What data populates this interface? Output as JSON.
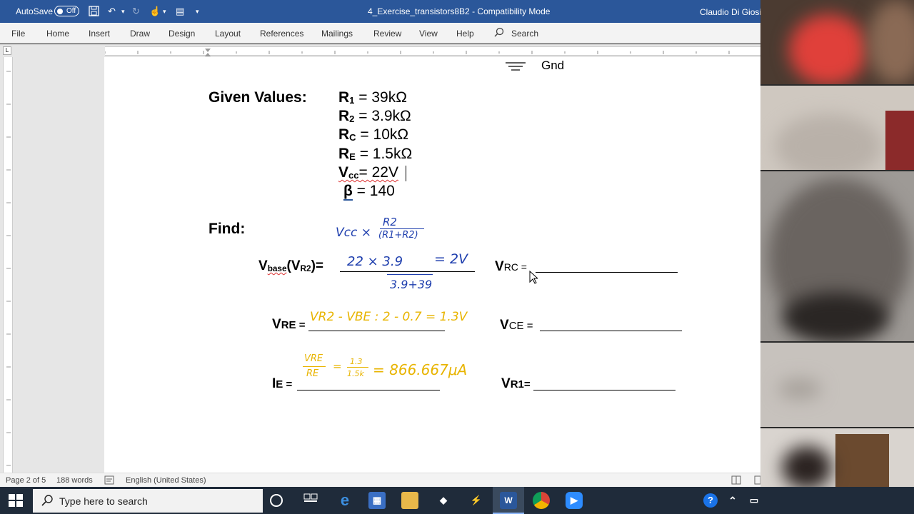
{
  "titlebar": {
    "autosave_label": "AutoSave",
    "autosave_state": "Off",
    "document_title": "4_Exercise_transistors8B2  -  Compatibility Mode",
    "user_name": "Claudio Di Giosia"
  },
  "ribbon": {
    "tabs": [
      "File",
      "Home",
      "Insert",
      "Draw",
      "Design",
      "Layout",
      "References",
      "Mailings",
      "Review",
      "View",
      "Help"
    ],
    "search_label": "Search"
  },
  "document": {
    "gnd_label": "Gnd",
    "given_label": "Given Values:",
    "given": [
      {
        "sym": "R",
        "sub": "1",
        "value": " = 39kΩ"
      },
      {
        "sym": "R",
        "sub": "2",
        "value": " = 3.9kΩ"
      },
      {
        "sym": "R",
        "sub": "C",
        "value": " = 10kΩ"
      },
      {
        "sym": "R",
        "sub": "E",
        "value": " = 1.5kΩ"
      },
      {
        "sym": "V",
        "sub": "cc",
        "value": "= 22V"
      },
      {
        "sym": "β",
        "sub": "",
        "value": " = 140"
      }
    ],
    "find_label": "Find:",
    "vbase": {
      "sym": "V",
      "sub": "base",
      "rest": "(V",
      "sub2": "R2",
      "end": ")="
    },
    "vrc": {
      "sym": "V",
      "sub": "RC",
      "end": " ="
    },
    "vre": {
      "sym": "V",
      "sub": "RE",
      "end": " ="
    },
    "vce": {
      "sym": "V",
      "sub": "CE",
      "end": " ="
    },
    "ie": {
      "sym": "I",
      "sub": "E",
      "end": " ="
    },
    "vr1": {
      "sym": "V",
      "sub": "R1",
      "end": "="
    },
    "handwriting": {
      "formula_top": "Vcc ×",
      "formula_num": "R2",
      "formula_den": "(R1+R2)",
      "calc_num": "22  × 3.9",
      "calc_res": "= 2V",
      "calc_den": "3.9+39",
      "vre_work": "VR2 - VBE : 2 - 0.7 = 1.3V",
      "ie_frac_num": "VRE",
      "ie_frac_den": "RE",
      "ie_eq": "=",
      "ie_num2": "1.3",
      "ie_den2": "1.5k",
      "ie_result": "= 866.667μA"
    }
  },
  "statusbar": {
    "page": "Page 2 of 5",
    "words": "188 words",
    "language": "English (United States)"
  },
  "taskbar": {
    "search_placeholder": "Type here to search",
    "apps": [
      "cortana",
      "task-view",
      "edge",
      "store",
      "file-explorer",
      "dropbox",
      "app",
      "word",
      "chrome",
      "zoom"
    ]
  },
  "colors": {
    "title_blue": "#2b579a",
    "ink_blue": "#1f3fae",
    "ink_yellow": "#e8b400"
  }
}
